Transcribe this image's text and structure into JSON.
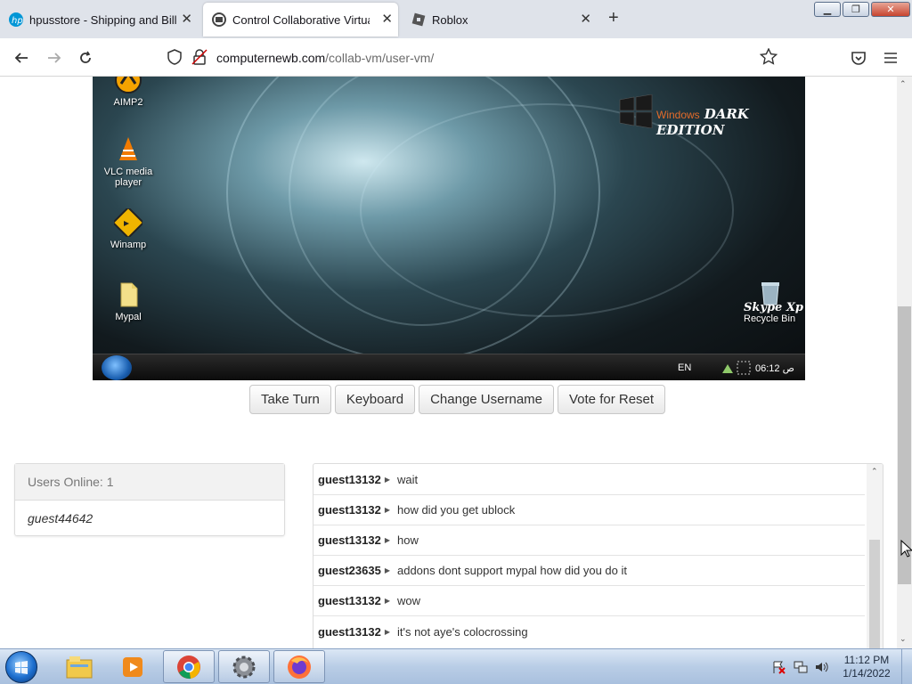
{
  "browser": {
    "tabs": [
      {
        "title": "hpusstore - Shipping and Billing",
        "icon": "hp-logo-icon",
        "active": false
      },
      {
        "title": "Control Collaborative Virtual M",
        "icon": "collabvm-icon",
        "active": true
      },
      {
        "title": "Roblox",
        "icon": "roblox-icon",
        "active": false
      }
    ],
    "url_host": "computernewb.com",
    "url_path": "/collab-vm/user-vm/"
  },
  "vm_screen": {
    "desktop_icons": [
      {
        "label": "AIMP2",
        "icon": "aimp-icon"
      },
      {
        "label": "VLC media player",
        "icon": "vlc-icon"
      },
      {
        "label": "Winamp",
        "icon": "winamp-icon"
      },
      {
        "label": "Mypal",
        "icon": "folder-icon"
      }
    ],
    "branding": {
      "windows": "Windows",
      "edition": "DARK EDITION",
      "skype": "Skype Xp"
    },
    "recycle_bin": "Recycle Bin",
    "taskbar": {
      "language": "EN",
      "clock": "06:12 ص"
    }
  },
  "controls": {
    "take_turn": "Take Turn",
    "keyboard": "Keyboard",
    "change_username": "Change Username",
    "vote_reset": "Vote for Reset"
  },
  "users": {
    "header": "Users Online: 1",
    "list": [
      "guest44642"
    ]
  },
  "chat": [
    {
      "user": "guest13132",
      "text": "wait"
    },
    {
      "user": "guest13132",
      "text": "how did you get ublock"
    },
    {
      "user": "guest13132",
      "text": "how"
    },
    {
      "user": "guest23635",
      "text": "addons dont support mypal how did you do it"
    },
    {
      "user": "guest13132",
      "text": "wow"
    },
    {
      "user": "guest13132",
      "text": "it's not aye's colocrossing"
    }
  ],
  "os_taskbar": {
    "time": "11:12 PM",
    "date": "1/14/2022",
    "apps": [
      "explorer-icon",
      "media-player-icon",
      "chrome-icon",
      "settings-gear-icon",
      "firefox-icon"
    ]
  }
}
